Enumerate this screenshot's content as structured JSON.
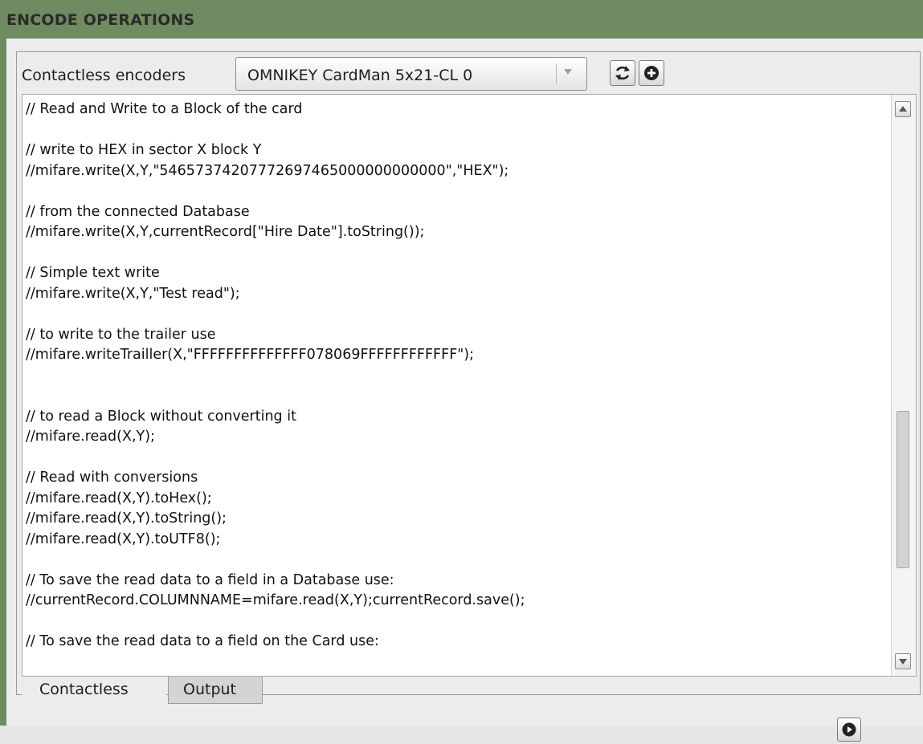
{
  "header": {
    "title": "ENCODE OPERATIONS"
  },
  "encoders": {
    "label": "Contactless encoders",
    "selected": "OMNIKEY CardMan 5x21-CL 0",
    "refresh_icon": "refresh-icon",
    "add_icon": "add-icon"
  },
  "editor": {
    "lines": [
      "// Read and Write to a Block of the card",
      "",
      "// write to HEX in sector X block Y",
      "//mifare.write(X,Y,\"54657374207772697465000000000000\",\"HEX\");",
      "",
      "// from the connected Database",
      "//mifare.write(X,Y,currentRecord[\"Hire Date\"].toString());",
      "",
      "// Simple text write",
      "//mifare.write(X,Y,\"Test read\");",
      "",
      "// to write to the trailer use",
      "//mifare.writeTrailler(X,\"FFFFFFFFFFFFFF078069FFFFFFFFFFFF\");",
      "",
      "",
      "// to read a Block without converting it",
      "//mifare.read(X,Y);",
      "",
      "// Read with conversions",
      "//mifare.read(X,Y).toHex();",
      "//mifare.read(X,Y).toString();",
      "//mifare.read(X,Y).toUTF8();",
      "",
      "// To save the read data to a field in a Database use:",
      "//currentRecord.COLUMNNAME=mifare.read(X,Y);currentRecord.save();",
      "",
      "// To save the read data to a field on the Card use:"
    ]
  },
  "tabs": {
    "contactless": "Contactless",
    "output": "Output"
  },
  "run": {
    "icon": "play-icon"
  },
  "colors": {
    "header_bg": "#6e8b62",
    "panel_bg": "#ececec",
    "editor_bg": "#ffffff"
  }
}
